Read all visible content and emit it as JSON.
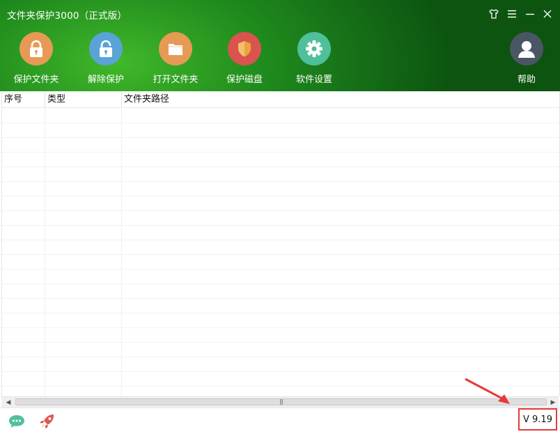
{
  "window": {
    "title": "文件夹保护3000（正式版）"
  },
  "controls": [
    {
      "name": "skin-icon"
    },
    {
      "name": "menu-icon"
    },
    {
      "name": "minimize-icon"
    },
    {
      "name": "close-icon"
    }
  ],
  "toolbar": {
    "protect_folder": "保护文件夹",
    "unprotect": "解除保护",
    "open_folder": "打开文件夹",
    "protect_disk": "保护磁盘",
    "settings": "软件设置",
    "help": "帮助"
  },
  "table": {
    "columns": [
      "序号",
      "类型",
      "文件夹路径"
    ],
    "rows": []
  },
  "statusbar": {
    "version": "V 9.19"
  },
  "colors": {
    "header_dark": "#0c5410",
    "header_light": "#41b82a",
    "protect_icon": "#e79a55",
    "unprotect_icon": "#5aa3d6",
    "open_icon": "#e79a55",
    "disk_icon": "#d9534f",
    "settings_icon": "#4fbf9c",
    "help_icon": "#4a5663",
    "highlight": "#e63a3a"
  }
}
